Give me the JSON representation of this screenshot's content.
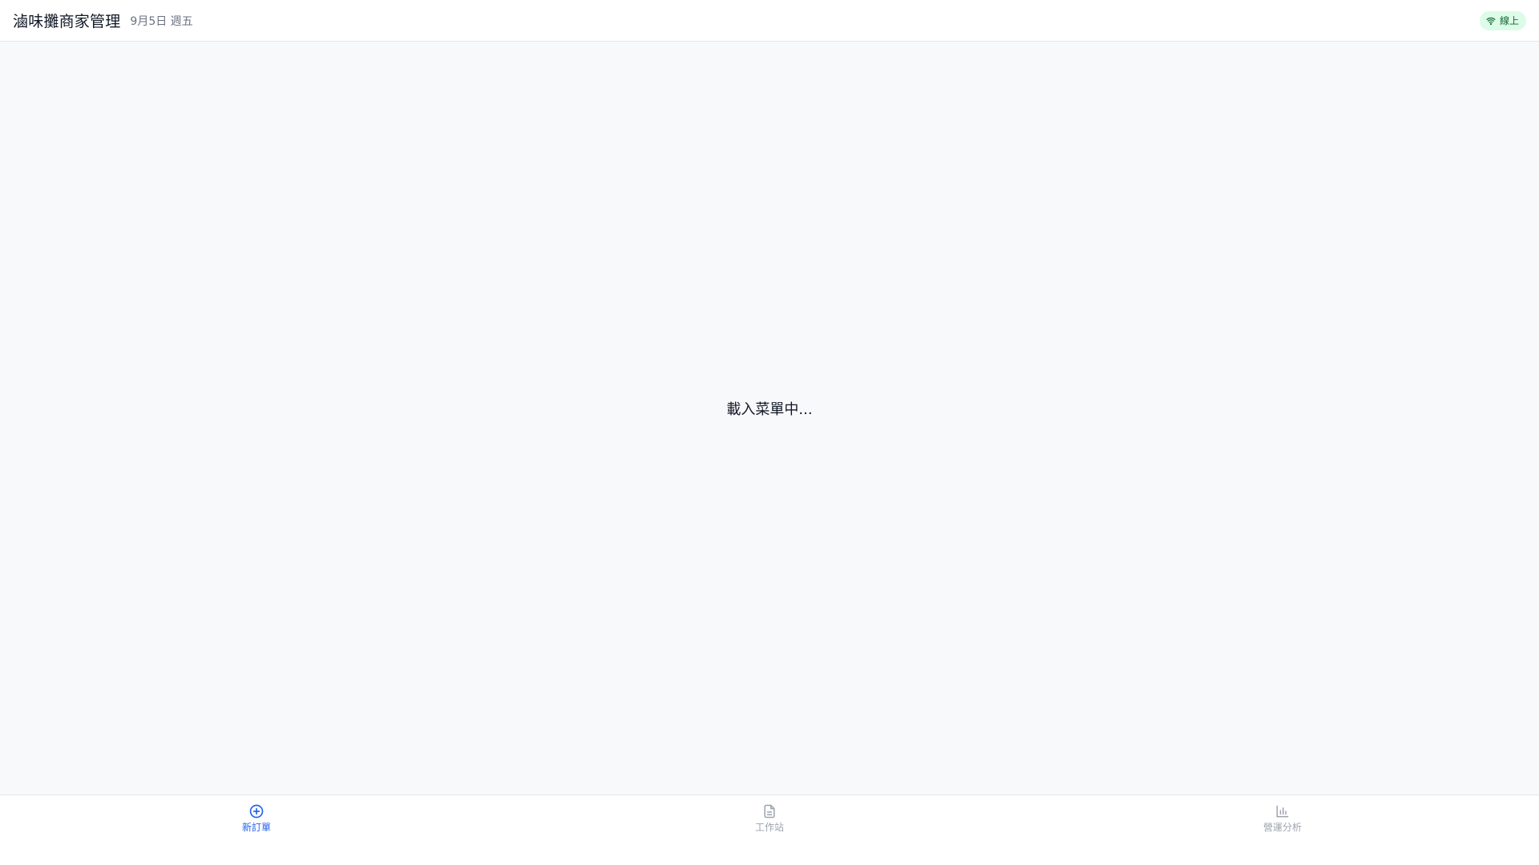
{
  "header": {
    "title": "滷味攤商家管理",
    "date": "9月5日 週五",
    "status": {
      "label": "線上",
      "icon": "wifi-icon",
      "color": "#166534",
      "background": "#dcfce7"
    }
  },
  "main": {
    "loading_text": "載入菜單中..."
  },
  "bottom_nav": {
    "active_color": "#2563eb",
    "inactive_color": "#9ca3af",
    "items": [
      {
        "label": "新訂單",
        "icon": "plus-circle-icon",
        "active": true
      },
      {
        "label": "工作站",
        "icon": "document-icon",
        "active": false
      },
      {
        "label": "營運分析",
        "icon": "bar-chart-icon",
        "active": false
      }
    ]
  }
}
